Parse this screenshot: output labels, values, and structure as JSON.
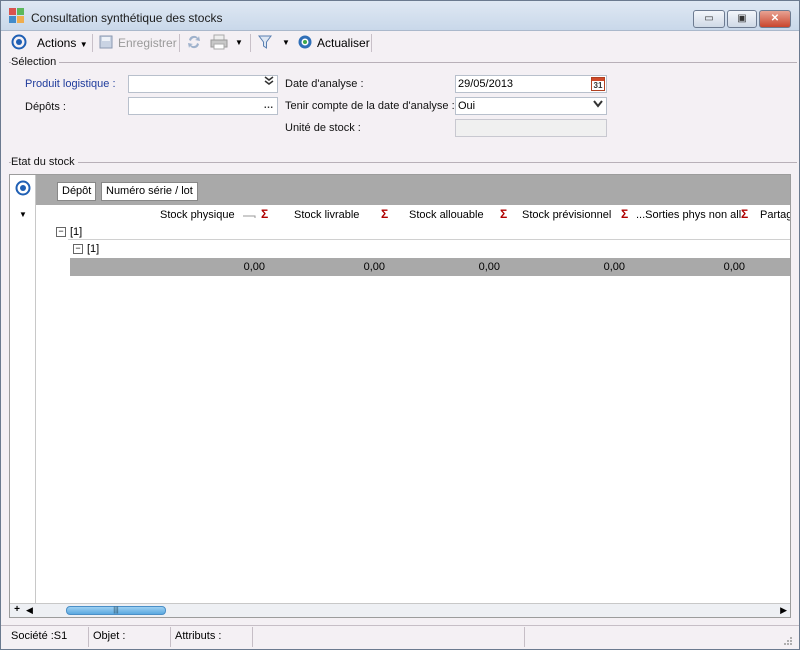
{
  "window": {
    "title": "Consultation synthétique des stocks",
    "minimize_glyph": "▭",
    "maximize_glyph": "▣",
    "close_glyph": "✕"
  },
  "toolbar": {
    "actions_label": "Actions",
    "save_label": "Enregistrer",
    "refresh_label": "Actualiser"
  },
  "selection": {
    "section_title": "Sélection",
    "produit_label": "Produit logistique :",
    "produit_value": "",
    "depots_label": "Dépôts :",
    "depots_value": "",
    "date_label": "Date d'analyse :",
    "date_value": "29/05/2013",
    "calendar_day": "31",
    "tenir_label": "Tenir compte de la date d'analyse :",
    "tenir_value": "Oui",
    "unite_label": "Unité de stock :",
    "unite_value": ""
  },
  "stock": {
    "section_title": "Etat du stock",
    "group_tabs": [
      "Dépôt",
      "Numéro série / lot"
    ],
    "columns": [
      "Stock physique",
      "Stock livrable",
      "Stock allouable",
      "Stock prévisionnel",
      "...Sorties phys non all",
      "Partag"
    ],
    "sigma": "Σ",
    "tree": {
      "level1_label": "[1]",
      "level2_label": "[1]",
      "expander_glyph": "−"
    },
    "totals": [
      "0,00",
      "0,00",
      "0,00",
      "0,00",
      "0,00"
    ],
    "scroll_add_glyph": "+",
    "scroll_left_glyph": "◀",
    "scroll_right_glyph": "▶",
    "scroll_grip": "|||"
  },
  "statusbar": {
    "societe": "Société :S1",
    "objet": "Objet :",
    "attributs": "Attributs :"
  },
  "colors": {
    "accent_blue": "#1f5fb4",
    "sigma_red": "#b00000",
    "group_gray": "#a9a9a9",
    "window_bg": "#f4f0f4"
  }
}
